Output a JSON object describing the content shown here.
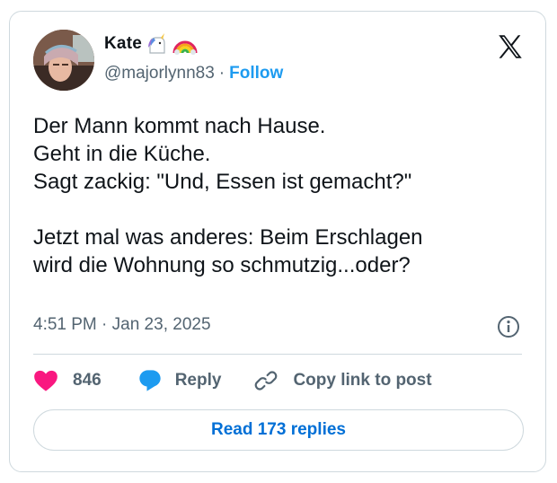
{
  "author": {
    "display_name": "Kate",
    "name_emojis": [
      "unicorn-icon",
      "rainbow-icon"
    ],
    "handle": "@majorlynn83",
    "separator": "·",
    "follow_label": "Follow"
  },
  "tweet": {
    "lines": [
      "Der Mann kommt nach Hause.",
      "Geht in die Küche.",
      "Sagt zackig: \"Und, Essen ist gemacht?\"",
      "Jetzt mal was anderes: Beim Erschlagen",
      "wird die Wohnung so schmutzig...oder?"
    ],
    "timestamp": "4:51 PM · Jan 23, 2025"
  },
  "actions": {
    "like_count": "846",
    "reply_label": "Reply",
    "copy_label": "Copy link to post"
  },
  "read_replies_label": "Read 173 replies",
  "colors": {
    "accent": "#1d9bf0",
    "link_blue": "#006fd6",
    "like_pink": "#f91880",
    "muted_text": "#536471",
    "border": "#cfd9de"
  }
}
